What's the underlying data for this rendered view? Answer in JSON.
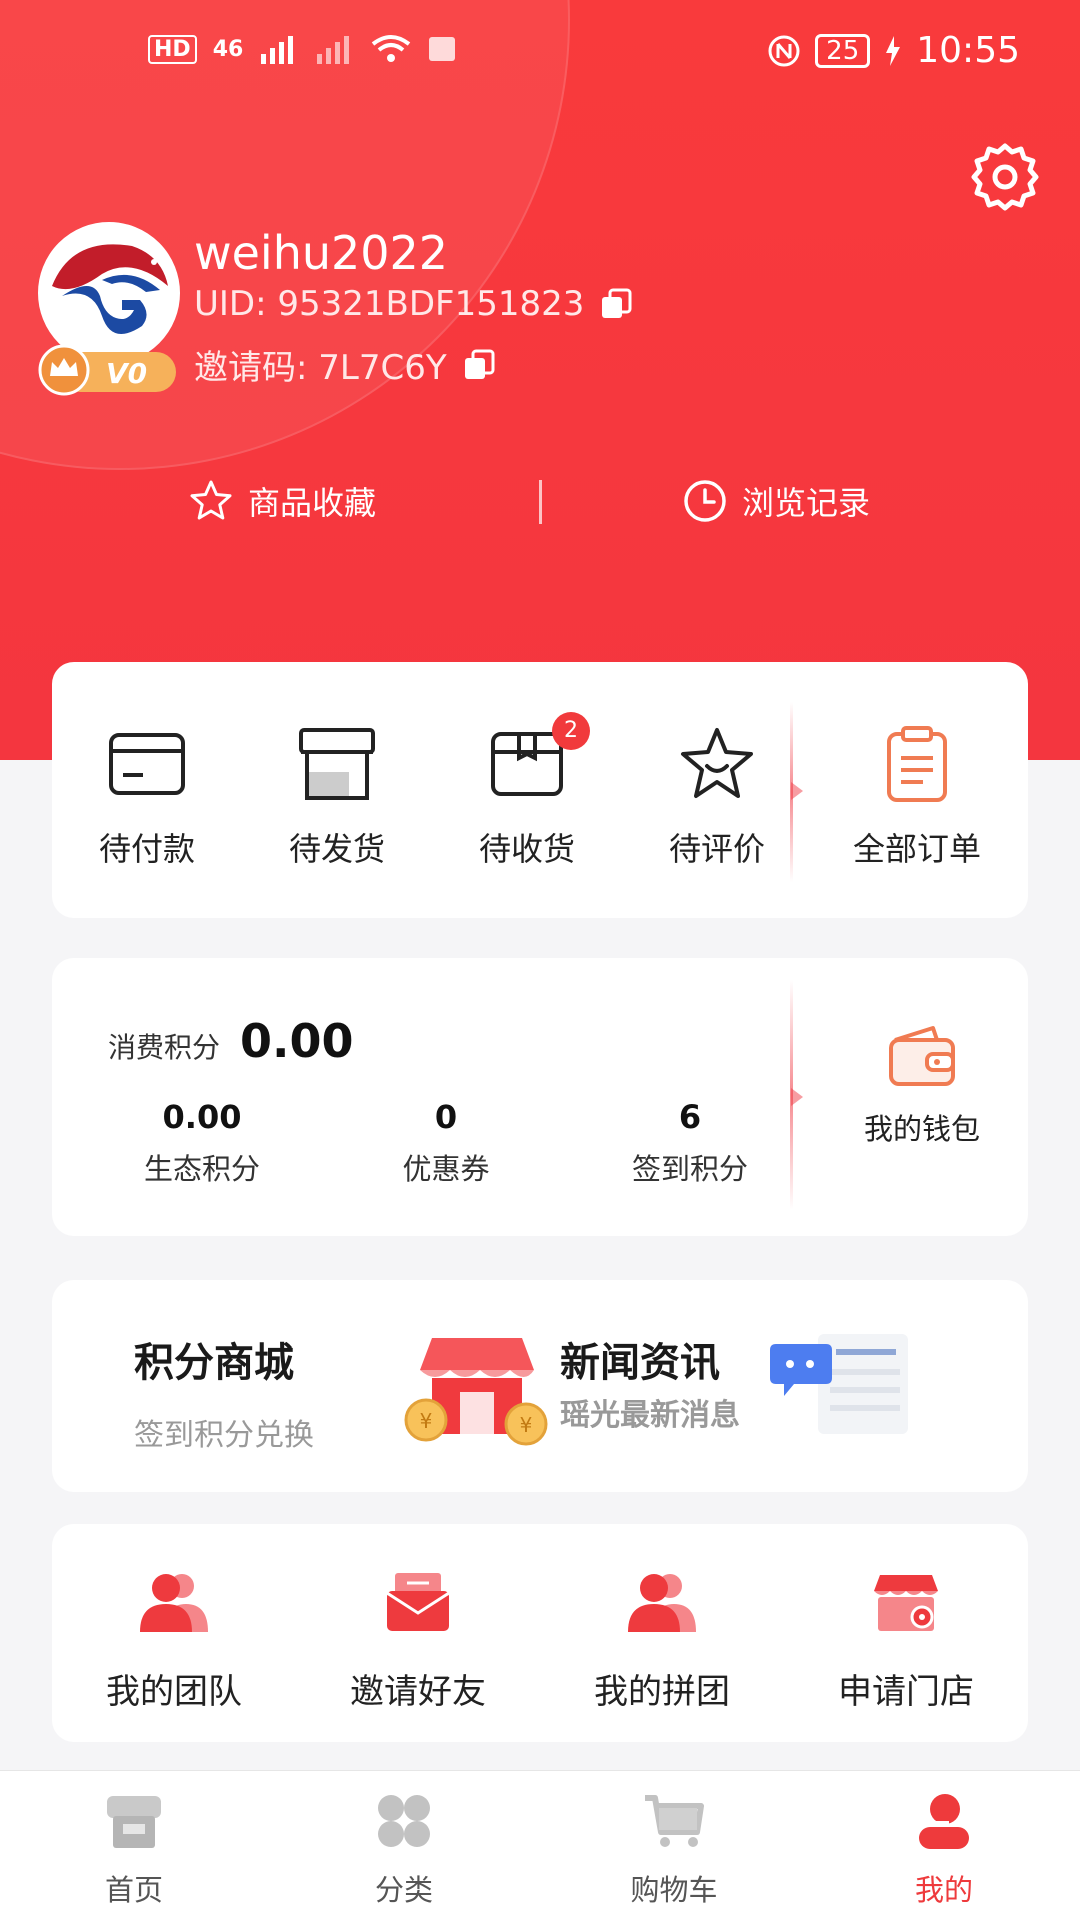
{
  "status_bar": {
    "left_badges": [
      "HD",
      "46"
    ],
    "battery": "25",
    "time": "10:55"
  },
  "profile": {
    "username": "weihu2022",
    "uid_label": "UID:",
    "uid_value": "95321BDF151823",
    "invite_label": "邀请码:",
    "invite_value": "7L7C6Y",
    "vip_level": "V0"
  },
  "quick_links": [
    {
      "label": "商品收藏",
      "icon": "star-icon"
    },
    {
      "label": "浏览记录",
      "icon": "clock-icon"
    }
  ],
  "orders": {
    "items": [
      {
        "label": "待付款",
        "icon": "wallet-card-icon"
      },
      {
        "label": "待发货",
        "icon": "shop-icon"
      },
      {
        "label": "待收货",
        "icon": "box-icon",
        "badge": "2"
      },
      {
        "label": "待评价",
        "icon": "smile-star-icon"
      }
    ],
    "all": {
      "label": "全部订单",
      "icon": "clipboard-icon"
    }
  },
  "points": {
    "title": "消费积分",
    "value": "0.00",
    "items": [
      {
        "num": "0.00",
        "label": "生态积分"
      },
      {
        "num": "0",
        "label": "优惠券"
      },
      {
        "num": "6",
        "label": "签到积分"
      }
    ],
    "wallet_label": "我的钱包"
  },
  "promo": {
    "left": {
      "title": "积分商城",
      "subtitle": "签到积分兑换"
    },
    "right": {
      "title": "新闻资讯",
      "subtitle": "瑶光最新消息"
    }
  },
  "services": [
    {
      "label": "我的团队",
      "icon": "team-icon"
    },
    {
      "label": "邀请好友",
      "icon": "envelope-icon"
    },
    {
      "label": "我的拼团",
      "icon": "group-icon"
    },
    {
      "label": "申请门店",
      "icon": "store-icon"
    }
  ],
  "tabbar": [
    {
      "label": "首页",
      "icon": "home-icon"
    },
    {
      "label": "分类",
      "icon": "category-icon"
    },
    {
      "label": "购物车",
      "icon": "cart-icon"
    },
    {
      "label": "我的",
      "icon": "profile-icon",
      "active": true
    }
  ],
  "colors": {
    "primary": "#f4363f",
    "accent_orange": "#f07b52",
    "badge": "#f13a3c"
  }
}
